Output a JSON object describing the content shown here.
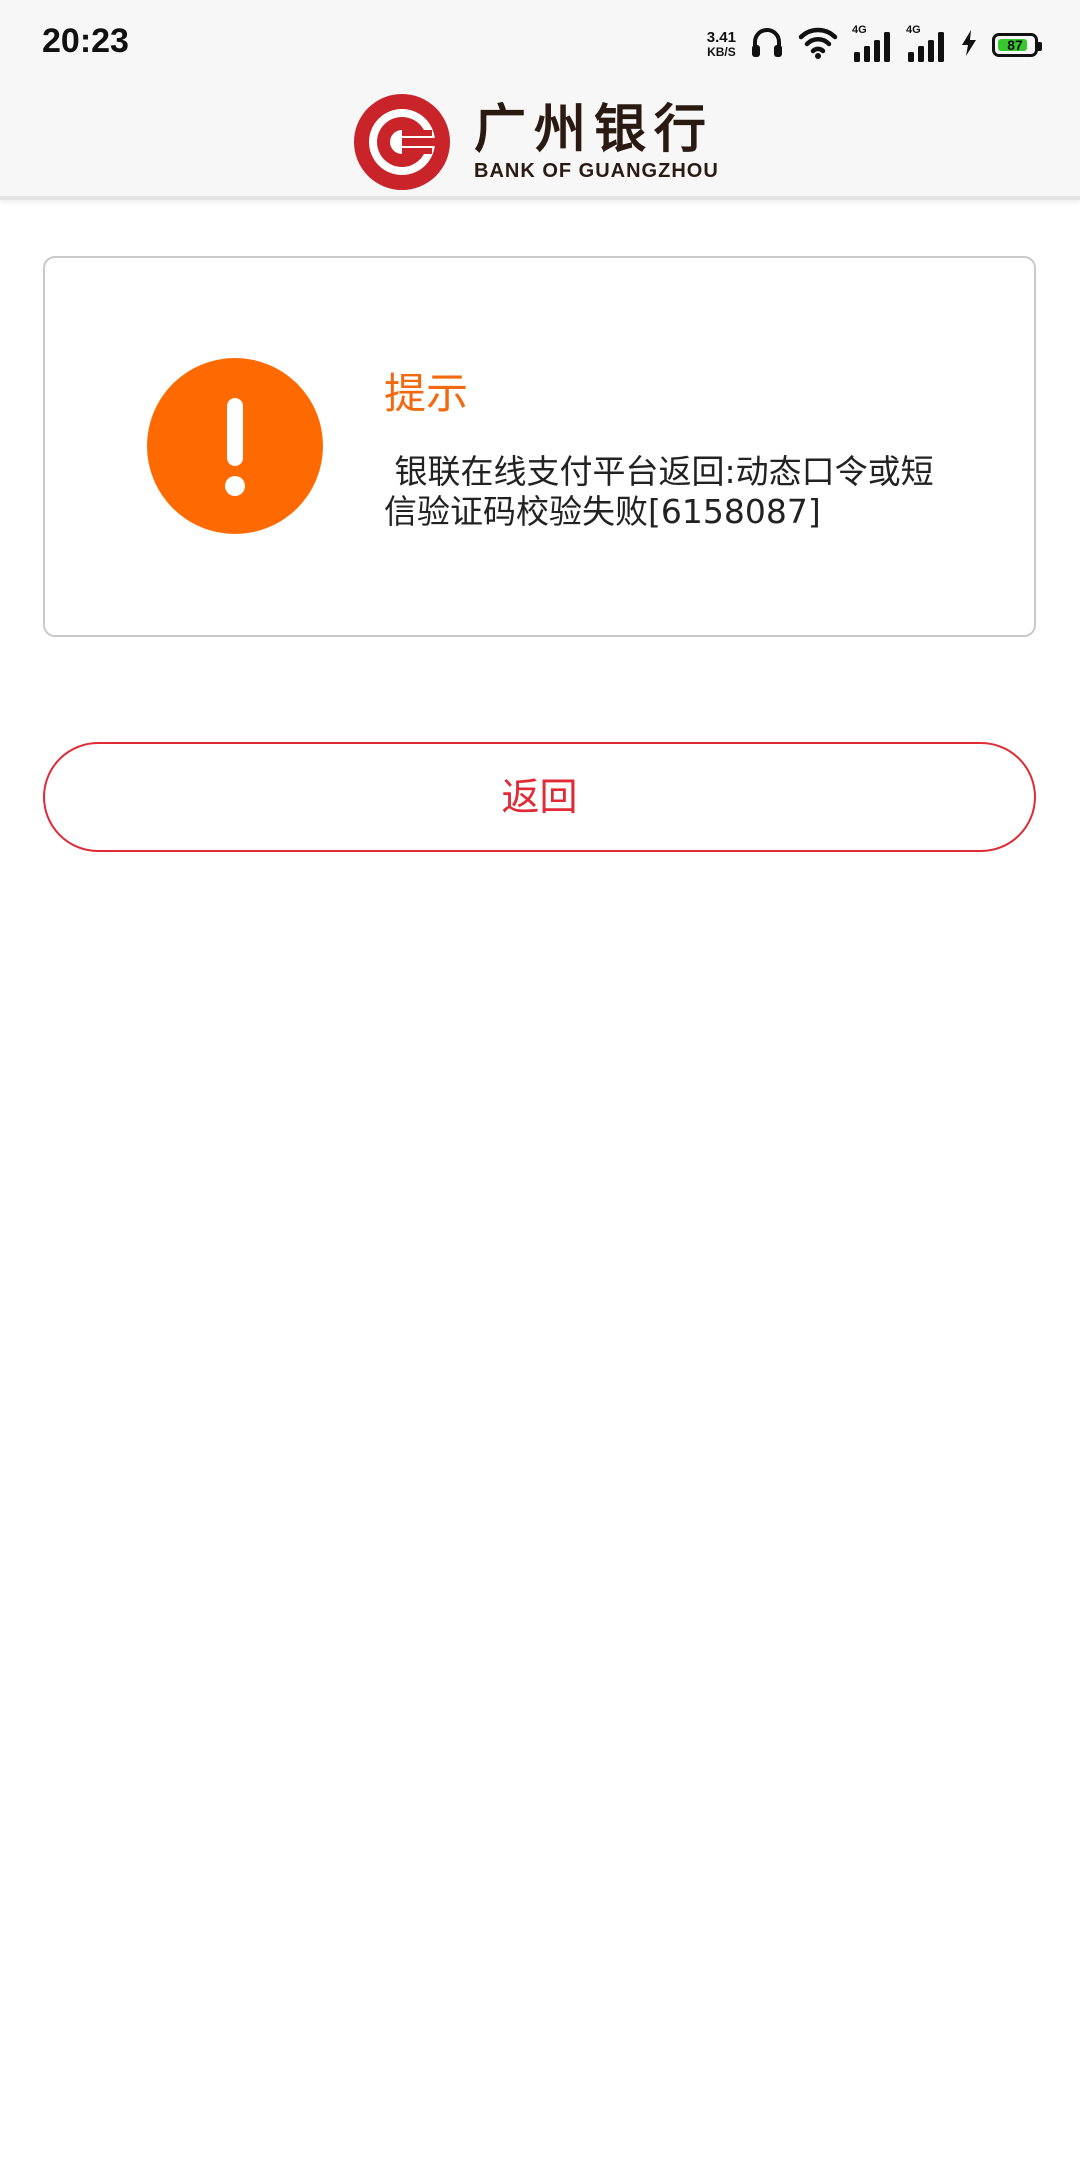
{
  "status_bar": {
    "time": "20:23",
    "net_speed_value": "3.41",
    "net_speed_unit": "KB/S",
    "sim1_tag": "4G",
    "sim2_tag": "4G",
    "battery_level": "87",
    "battery_color": "#36c92f",
    "icons": [
      "headphones-icon",
      "wifi-icon",
      "signal-icon",
      "signal-icon",
      "charging-icon",
      "battery-icon"
    ]
  },
  "header": {
    "brand_cn": "广州银行",
    "brand_en": "BANK OF GUANGZHOU",
    "brand_color": "#c8242a"
  },
  "alert": {
    "icon": "exclamation-icon",
    "icon_color": "#ff6a00",
    "title": "提示",
    "message": " 银联在线支付平台返回:动态口令或短信验证码校验失败[6158087]"
  },
  "actions": {
    "back_label": "返回",
    "accent_color": "#e02a36"
  }
}
